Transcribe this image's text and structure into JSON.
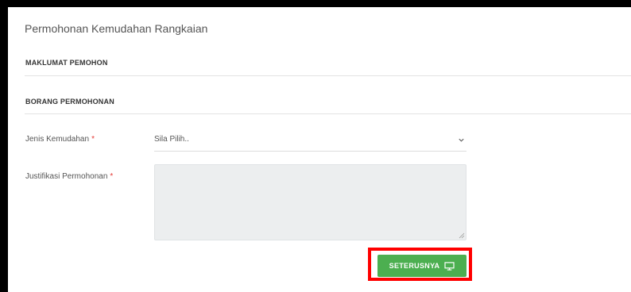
{
  "page": {
    "title": "Permohonan Kemudahan Rangkaian"
  },
  "sections": {
    "applicant_info": "MAKLUMAT PEMOHON",
    "application_form": "BORANG PERMOHONAN"
  },
  "form": {
    "facility_type": {
      "label": "Jenis Kemudahan",
      "required_marker": "*",
      "selected_value": "Sila Pilih.."
    },
    "justification": {
      "label": "Justifikasi Permohonan",
      "required_marker": "*",
      "value": ""
    }
  },
  "actions": {
    "next_label": "SETERUSNYA",
    "next_icon": "monitor-icon"
  },
  "colors": {
    "primary_button": "#4caf50",
    "highlight": "#ff0000",
    "required": "#e53935"
  }
}
